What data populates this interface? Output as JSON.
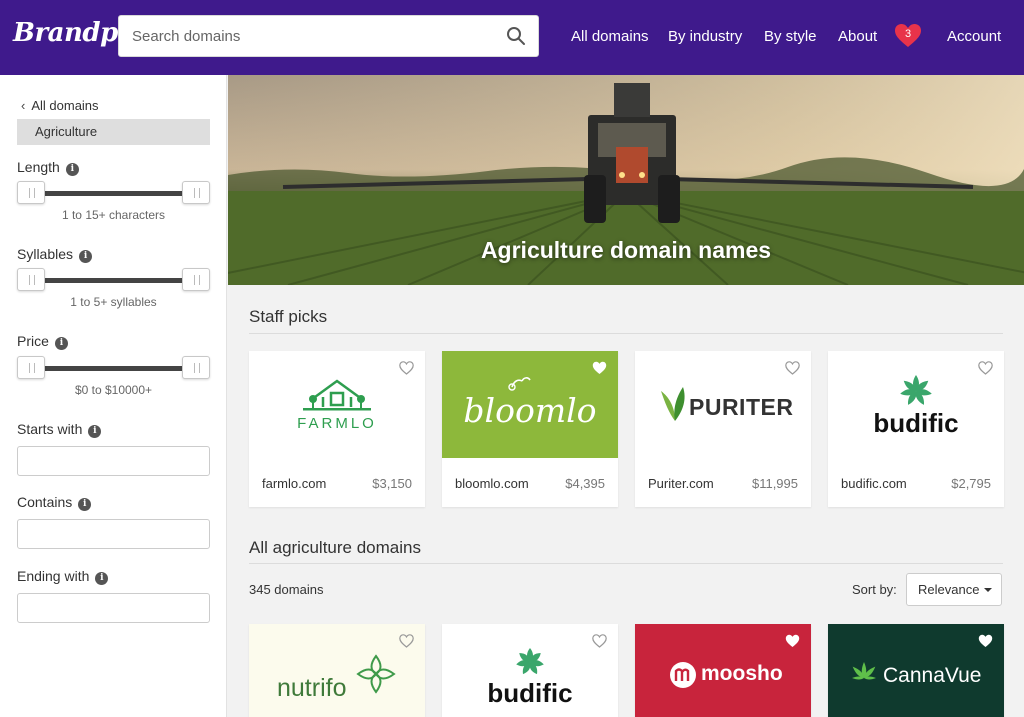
{
  "header": {
    "logo": "Brandpa",
    "search_placeholder": "Search domains",
    "nav": [
      {
        "label": "All domains"
      },
      {
        "label": "By industry"
      },
      {
        "label": "By style"
      },
      {
        "label": "About"
      }
    ],
    "favorites_count": "3",
    "account_label": "Account"
  },
  "sidebar": {
    "back_label": "All domains",
    "current_industry": "Agriculture",
    "length": {
      "label": "Length",
      "range": "1 to 15+ characters"
    },
    "syllables": {
      "label": "Syllables",
      "range": "1 to 5+ syllables"
    },
    "price": {
      "label": "Price",
      "range": "$0 to $10000+"
    },
    "starts_with": {
      "label": "Starts with",
      "value": ""
    },
    "contains": {
      "label": "Contains",
      "value": ""
    },
    "ending_with": {
      "label": "Ending with",
      "value": ""
    }
  },
  "hero": {
    "title": "Agriculture domain names"
  },
  "staff_picks": {
    "title": "Staff picks",
    "cards": [
      {
        "logo_text": "FARMLO",
        "domain": "farmlo.com",
        "price": "$3,150",
        "favorited": false
      },
      {
        "logo_text": "bloomlo",
        "domain": "bloomlo.com",
        "price": "$4,395",
        "favorited": true
      },
      {
        "logo_text": "PURITER",
        "domain": "Puriter.com",
        "price": "$11,995",
        "favorited": false
      },
      {
        "logo_text": "budific",
        "domain": "budific.com",
        "price": "$2,795",
        "favorited": false
      }
    ]
  },
  "all_domains": {
    "title": "All agriculture domains",
    "count": "345 domains",
    "sort_label": "Sort by:",
    "sort_value": "Relevance",
    "cards": [
      {
        "logo_text": "nutrifo",
        "favorited": false
      },
      {
        "logo_text": "budific",
        "favorited": false
      },
      {
        "logo_text": "moosho",
        "favorited": true
      },
      {
        "logo_text": "CannaVue",
        "favorited": true
      }
    ]
  },
  "colors": {
    "header_bg": "#3f1a8c",
    "farmlo_green": "#2e9e4f",
    "bloomlo_bg": "#8db83b",
    "puriter_green": "#5aa83a",
    "moosho_bg": "#c8243c",
    "cannavue_bg": "#0f3a2e"
  },
  "icons": [
    "search-icon",
    "heart-icon",
    "chevron-left-icon",
    "info-icon",
    "caret-down-icon"
  ]
}
